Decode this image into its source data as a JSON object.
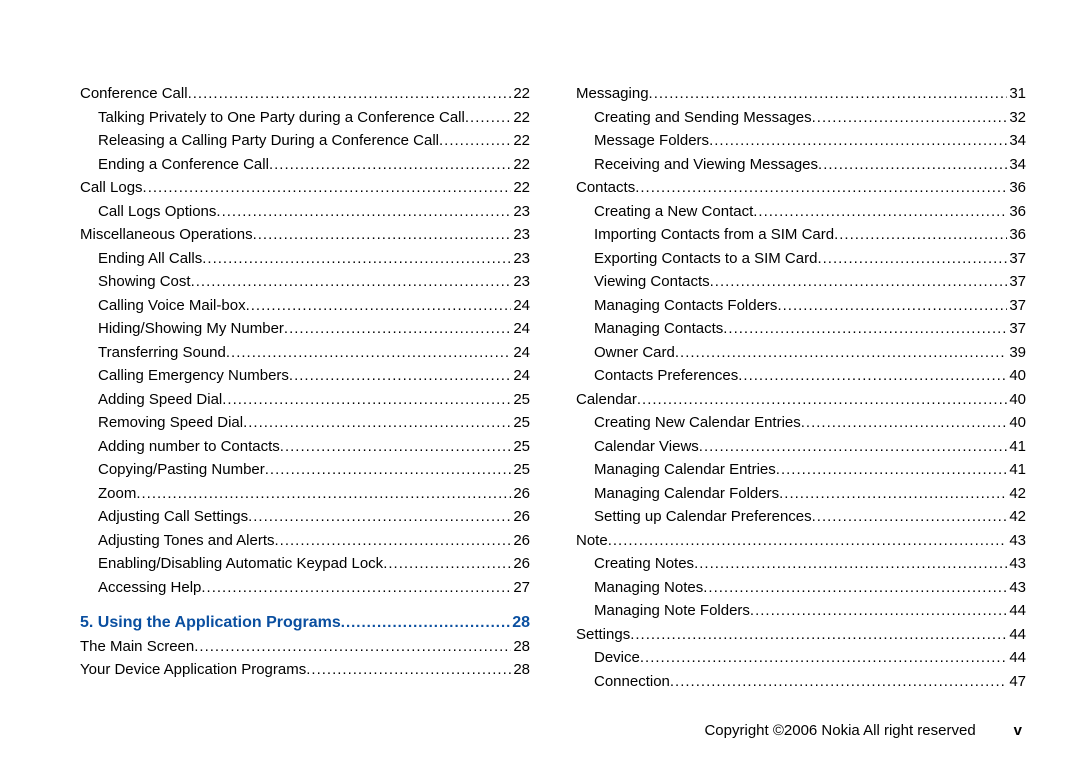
{
  "left": [
    {
      "label": "Conference Call",
      "page": "22",
      "indent": 0
    },
    {
      "label": "Talking Privately to One Party during a Conference Call",
      "page": "22",
      "indent": 1
    },
    {
      "label": "Releasing a Calling Party During a Conference Call",
      "page": "22",
      "indent": 1
    },
    {
      "label": "Ending a Conference Call",
      "page": "22",
      "indent": 1
    },
    {
      "label": "Call Logs",
      "page": "22",
      "indent": 0
    },
    {
      "label": "Call Logs Options",
      "page": "23",
      "indent": 1
    },
    {
      "label": "Miscellaneous Operations",
      "page": "23",
      "indent": 0
    },
    {
      "label": "Ending All Calls",
      "page": "23",
      "indent": 1
    },
    {
      "label": "Showing Cost",
      "page": "23",
      "indent": 1
    },
    {
      "label": "Calling Voice Mail-box",
      "page": "24",
      "indent": 1
    },
    {
      "label": "Hiding/Showing My Number",
      "page": "24",
      "indent": 1
    },
    {
      "label": "Transferring Sound",
      "page": "24",
      "indent": 1
    },
    {
      "label": "Calling Emergency Numbers",
      "page": "24",
      "indent": 1
    },
    {
      "label": "Adding Speed Dial",
      "page": "25",
      "indent": 1
    },
    {
      "label": "Removing Speed Dial",
      "page": "25",
      "indent": 1
    },
    {
      "label": "Adding number to Contacts",
      "page": "25",
      "indent": 1
    },
    {
      "label": "Copying/Pasting Number",
      "page": "25",
      "indent": 1
    },
    {
      "label": "Zoom",
      "page": "26",
      "indent": 1
    },
    {
      "label": "Adjusting Call Settings",
      "page": "26",
      "indent": 1
    },
    {
      "label": "Adjusting Tones and Alerts",
      "page": "26",
      "indent": 1
    },
    {
      "label": "Enabling/Disabling Automatic Keypad Lock",
      "page": "26",
      "indent": 1
    },
    {
      "label": "Accessing Help",
      "page": "27",
      "indent": 1
    }
  ],
  "section": {
    "label": "5. Using the Application Programs",
    "page": "28"
  },
  "left2": [
    {
      "label": "The Main Screen",
      "page": "28",
      "indent": 0
    },
    {
      "label": "Your Device Application Programs",
      "page": "28",
      "indent": 0
    }
  ],
  "right": [
    {
      "label": "Messaging",
      "page": "31",
      "indent": 0
    },
    {
      "label": "Creating and Sending Messages",
      "page": "32",
      "indent": 1
    },
    {
      "label": "Message Folders",
      "page": "34",
      "indent": 1
    },
    {
      "label": "Receiving and Viewing Messages",
      "page": "34",
      "indent": 1
    },
    {
      "label": "Contacts",
      "page": "36",
      "indent": 0
    },
    {
      "label": "Creating a New Contact",
      "page": "36",
      "indent": 1
    },
    {
      "label": "Importing Contacts from a SIM Card",
      "page": "36",
      "indent": 1
    },
    {
      "label": "Exporting Contacts to a SIM Card",
      "page": "37",
      "indent": 1
    },
    {
      "label": "Viewing Contacts",
      "page": "37",
      "indent": 1
    },
    {
      "label": "Managing Contacts Folders",
      "page": "37",
      "indent": 1
    },
    {
      "label": "Managing Contacts",
      "page": "37",
      "indent": 1
    },
    {
      "label": "Owner Card",
      "page": "39",
      "indent": 1
    },
    {
      "label": "Contacts Preferences",
      "page": "40",
      "indent": 1
    },
    {
      "label": "Calendar",
      "page": "40",
      "indent": 0
    },
    {
      "label": "Creating New Calendar Entries",
      "page": "40",
      "indent": 1
    },
    {
      "label": "Calendar Views",
      "page": "41",
      "indent": 1
    },
    {
      "label": "Managing Calendar Entries",
      "page": "41",
      "indent": 1
    },
    {
      "label": "Managing Calendar Folders",
      "page": "42",
      "indent": 1
    },
    {
      "label": "Setting up Calendar Preferences",
      "page": "42",
      "indent": 1
    },
    {
      "label": "Note",
      "page": "43",
      "indent": 0
    },
    {
      "label": "Creating Notes",
      "page": "43",
      "indent": 1
    },
    {
      "label": "Managing Notes",
      "page": "43",
      "indent": 1
    },
    {
      "label": "Managing Note Folders",
      "page": "44",
      "indent": 1
    },
    {
      "label": "Settings",
      "page": "44",
      "indent": 0
    },
    {
      "label": "Device",
      "page": "44",
      "indent": 1
    },
    {
      "label": "Connection",
      "page": "47",
      "indent": 1
    }
  ],
  "footer": {
    "copyright": "Copyright ©2006 Nokia All right reserved",
    "pagenum": "v"
  }
}
